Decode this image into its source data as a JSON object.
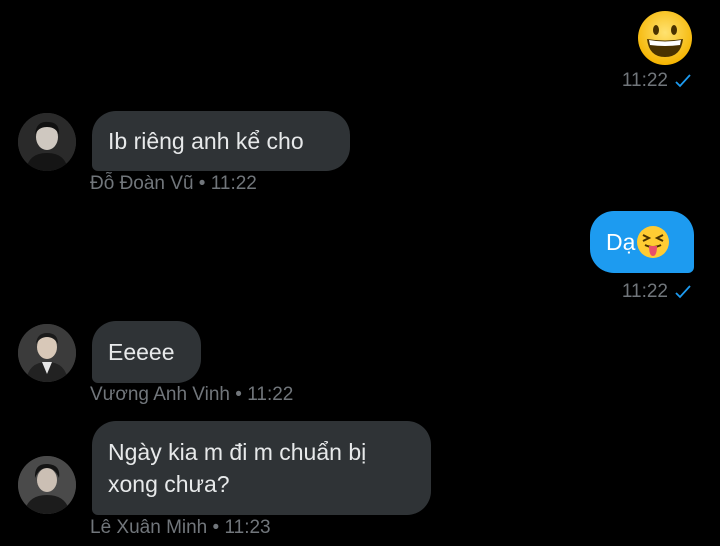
{
  "conversation": {
    "messages": [
      {
        "type": "out-emoji",
        "emoji_name": "grinning-face-icon",
        "time": "11:22"
      },
      {
        "type": "in",
        "text": "Ib riêng anh kể cho",
        "sender": "Đỗ Đoàn Vũ",
        "time": "11:22"
      },
      {
        "type": "out",
        "text": "Dạ",
        "emoji_name": "squinting-tongue-face-icon",
        "time": "11:22"
      },
      {
        "type": "in",
        "text": "Eeeee",
        "sender": "Vương Anh Vinh",
        "time": "11:22"
      },
      {
        "type": "in",
        "text_line1": "Ngày kia m đi m chuẩn bị",
        "text_line2": "xong chưa?",
        "sender": "Lê Xuân Minh",
        "time": "11:23"
      }
    ],
    "separator": "•",
    "colors": {
      "outgoing": "#1d9bf0",
      "incoming": "#2f3336",
      "meta": "#71767b",
      "check": "#1d9bf0"
    }
  }
}
